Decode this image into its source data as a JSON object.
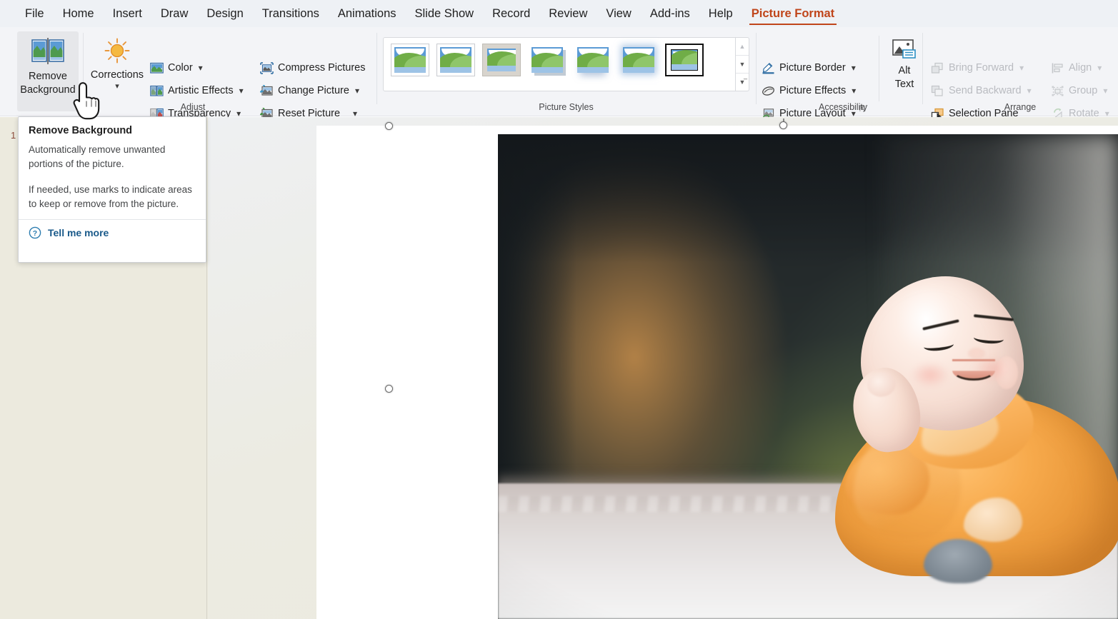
{
  "app": {
    "name": "PowerPoint",
    "accent_color": "#c0451a",
    "ribbon_bg": "#f3f4f7",
    "workspace_bg": "#eceade"
  },
  "tabs": [
    {
      "label": "File",
      "active": false
    },
    {
      "label": "Home",
      "active": false
    },
    {
      "label": "Insert",
      "active": false
    },
    {
      "label": "Draw",
      "active": false
    },
    {
      "label": "Design",
      "active": false
    },
    {
      "label": "Transitions",
      "active": false
    },
    {
      "label": "Animations",
      "active": false
    },
    {
      "label": "Slide Show",
      "active": false
    },
    {
      "label": "Record",
      "active": false
    },
    {
      "label": "Review",
      "active": false
    },
    {
      "label": "View",
      "active": false
    },
    {
      "label": "Add-ins",
      "active": false
    },
    {
      "label": "Help",
      "active": false
    },
    {
      "label": "Picture Format",
      "active": true
    }
  ],
  "ribbon": {
    "groups": [
      {
        "name": "adjust",
        "label": "Adjust",
        "big_buttons": [
          {
            "label_line1": "Remove",
            "label_line2": "Background",
            "icon": "remove-background-icon",
            "state": "highlighted",
            "has_chevron": false
          },
          {
            "label_line1": "Corrections",
            "label_line2": "",
            "icon": "brightness-sun-icon",
            "state": "normal",
            "has_chevron": true
          }
        ],
        "small_buttons": [
          {
            "label": "Color",
            "icon": "color-picture-icon",
            "chevron": true,
            "disabled": false
          },
          {
            "label": "Artistic Effects",
            "icon": "artistic-effects-icon",
            "chevron": true,
            "disabled": false
          },
          {
            "label": "Transparency",
            "icon": "transparency-icon",
            "chevron": true,
            "disabled": false
          },
          {
            "label": "Compress Pictures",
            "icon": "compress-pictures-icon",
            "chevron": false,
            "disabled": false
          },
          {
            "label": "Change Picture",
            "icon": "change-picture-icon",
            "chevron": true,
            "disabled": false
          },
          {
            "label": "Reset Picture",
            "icon": "reset-picture-icon",
            "chevron": true,
            "disabled": false
          }
        ]
      },
      {
        "name": "picture-styles",
        "label": "Picture Styles",
        "thumbnail_count": 7,
        "selected_index": 6,
        "scroll": {
          "up": "scroll-up-arrow",
          "down": "scroll-down-arrow",
          "more": "more-styles-arrow"
        }
      },
      {
        "name": "accessibility",
        "label": "Accessibility",
        "small_buttons": [
          {
            "label": "Picture Border",
            "icon": "picture-border-icon",
            "chevron": true,
            "disabled": false
          },
          {
            "label": "Picture Effects",
            "icon": "picture-effects-icon",
            "chevron": true,
            "disabled": false
          },
          {
            "label": "Picture Layout",
            "icon": "picture-layout-icon",
            "chevron": true,
            "disabled": false
          }
        ],
        "big_buttons": [
          {
            "label_line1": "Alt",
            "label_line2": "Text",
            "icon": "alt-text-icon",
            "state": "normal",
            "has_chevron": false
          }
        ],
        "dialog_launcher": "dialog-launcher-icon"
      },
      {
        "name": "arrange",
        "label": "Arrange",
        "small_buttons": [
          {
            "label": "Bring Forward",
            "icon": "bring-forward-icon",
            "chevron": true,
            "disabled": true
          },
          {
            "label": "Send Backward",
            "icon": "send-backward-icon",
            "chevron": true,
            "disabled": true
          },
          {
            "label": "Selection Pane",
            "icon": "selection-pane-icon",
            "chevron": false,
            "disabled": false
          },
          {
            "label": "Align",
            "icon": "align-icon",
            "chevron": true,
            "disabled": true
          },
          {
            "label": "Group",
            "icon": "group-icon",
            "chevron": true,
            "disabled": true
          },
          {
            "label": "Rotate",
            "icon": "rotate-icon",
            "chevron": true,
            "disabled": true
          }
        ]
      }
    ]
  },
  "tooltip": {
    "title": "Remove Background",
    "paragraph1": "Automatically remove unwanted portions of the picture.",
    "paragraph2": "If needed, use marks to indicate areas to keep or remove from the picture.",
    "link_label": "Tell me more",
    "link_icon": "help-question-icon"
  },
  "slide_panel": {
    "slide_number": "1"
  },
  "canvas": {
    "selected_object": "picture",
    "handles": [
      "top-left",
      "top-center",
      "middle-left"
    ],
    "picture_description": "Blurred dark background with smiling baby monk figurine in orange robe resting cheek on hand"
  },
  "cursor": {
    "icon": "pointing-hand-cursor"
  }
}
